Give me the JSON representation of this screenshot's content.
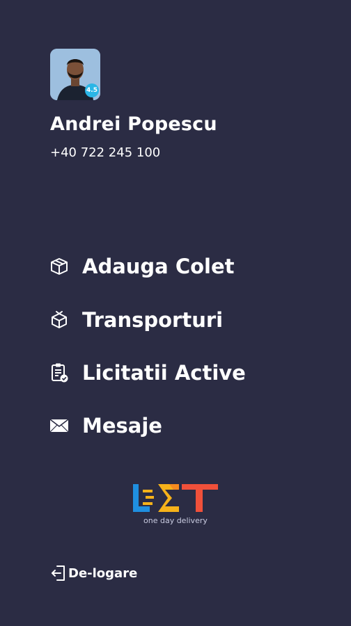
{
  "profile": {
    "name": "Andrei Popescu",
    "phone": "+40 722 245 100",
    "rating": "4.5"
  },
  "menu": {
    "items": [
      {
        "label": "Adauga Colet",
        "icon": "package-icon"
      },
      {
        "label": "Transporturi",
        "icon": "package-transfer-icon"
      },
      {
        "label": "Licitatii Active",
        "icon": "clipboard-check-icon"
      },
      {
        "label": "Mesaje",
        "icon": "envelope-icon"
      }
    ]
  },
  "logo": {
    "tagline": "one day delivery",
    "colors": [
      "#1f8fe0",
      "#f6b21a",
      "#f0503a"
    ]
  },
  "logout": {
    "label": "De-logare",
    "icon": "logout-icon"
  },
  "colors": {
    "background": "#2b2c44",
    "text": "#ffffff",
    "badge": "#2bb6e6"
  }
}
